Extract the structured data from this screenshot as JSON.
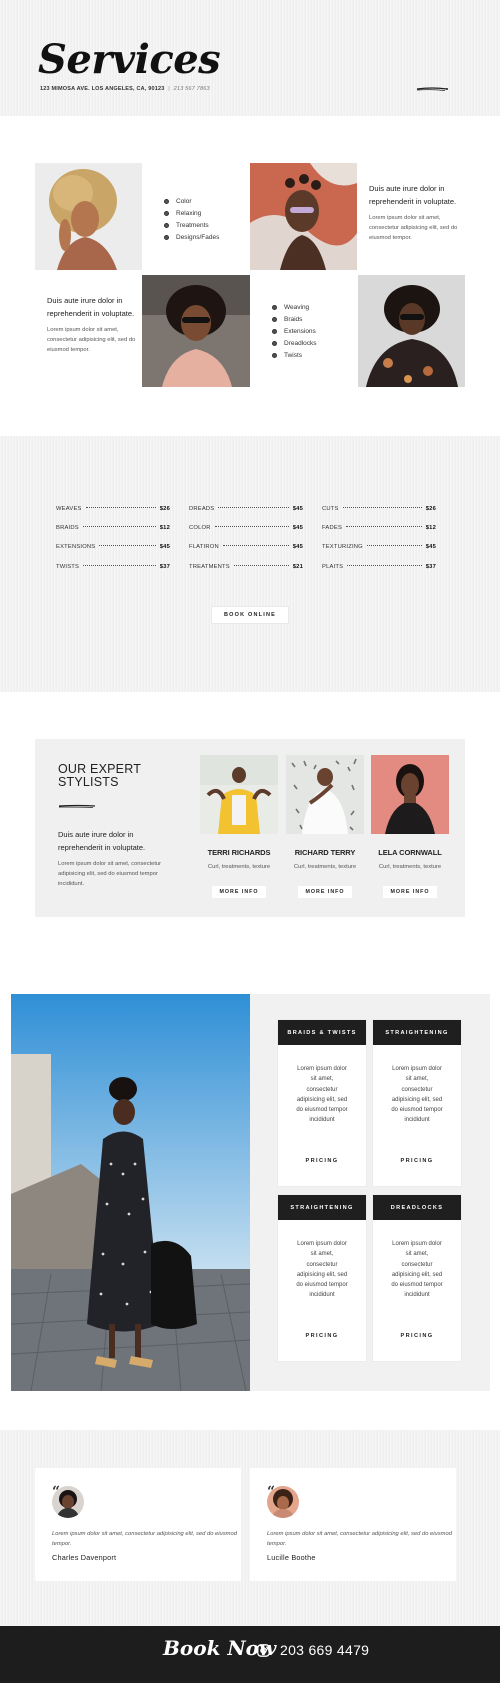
{
  "header": {
    "title": "Services",
    "address": "123 MIMOSA AVE. LOS ANGELES, CA, 90123",
    "separator": "|",
    "phone": "213 567 7863"
  },
  "services": {
    "list_one": [
      "Color",
      "Relaxing",
      "Treatments",
      "Designs/Fades"
    ],
    "list_two": [
      "Weaving",
      "Braids",
      "Extensions",
      "Dreadlocks",
      "Twists"
    ],
    "block_one": {
      "heading": "Duis aute irure dolor in reprehenderit in voluptate.",
      "body": "Lorem ipsum dolor sit amet, consectetur adipisicing elit, sed do eiusmod tempor."
    },
    "block_two": {
      "heading": "Duis aute irure dolor in reprehenderit in voluptate.",
      "body": "Lorem ipsum dolor sit amet, consectetur adipisicing elit, sed do eiusmod tempor."
    }
  },
  "prices": {
    "columns": [
      [
        {
          "name": "WEAVES",
          "price": "$26"
        },
        {
          "name": "BRAIDS",
          "price": "$12"
        },
        {
          "name": "EXTENSIONS",
          "price": "$45"
        },
        {
          "name": "TWISTS",
          "price": "$37"
        }
      ],
      [
        {
          "name": "DREADS",
          "price": "$45"
        },
        {
          "name": "COLOR",
          "price": "$45"
        },
        {
          "name": "FLATIRON",
          "price": "$45"
        },
        {
          "name": "TREATMENTS",
          "price": "$21"
        }
      ],
      [
        {
          "name": "CUTS",
          "price": "$26"
        },
        {
          "name": "FADES",
          "price": "$12"
        },
        {
          "name": "TEXTURIZING",
          "price": "$45"
        },
        {
          "name": "PLAITS",
          "price": "$37"
        }
      ]
    ],
    "book_button": "BOOK ONLINE"
  },
  "stylists": {
    "title_line1": "OUR EXPERT",
    "title_line2": "STYLISTS",
    "heading": "Duis aute irure dolor in reprehenderit in voluptate.",
    "body": "Lorem ipsum dolor sit amet, consectetur adipisicing elit, sed do eiusmod tempor incididunt.",
    "people": [
      {
        "name": "TERRI RICHARDS",
        "desc": "Curl, treatments, texture",
        "button": "MORE INFO"
      },
      {
        "name": "RICHARD TERRY",
        "desc": "Curl, treatments, texture",
        "button": "MORE INFO"
      },
      {
        "name": "LELA CORNWALL",
        "desc": "Curl, treatments, texture",
        "button": "MORE INFO"
      }
    ]
  },
  "pricing_cards": [
    {
      "title": "BRAIDS & TWISTS",
      "body": "Lorem ipsum dolor sit amet, consectetur adipisicing elit, sed do eiusmod tempor incididunt",
      "button": "PRICING"
    },
    {
      "title": "STRAIGHTENING",
      "body": "Lorem ipsum dolor sit amet, consectetur adipisicing elit, sed do eiusmod tempor incididunt",
      "button": "PRICING"
    },
    {
      "title": "STRAIGHTENING",
      "body": "Lorem ipsum dolor sit amet, consectetur adipisicing elit, sed do eiusmod tempor incididunt",
      "button": "PRICING"
    },
    {
      "title": "DREADLOCKS",
      "body": "Lorem ipsum dolor sit amet, consectetur adipisicing elit, sed do eiusmod tempor incididunt",
      "button": "PRICING"
    }
  ],
  "testimonials": [
    {
      "quote_mark": "“",
      "text": "Lorem ipsum dolor sit amet, consectetur adipisicing elit, sed do eiusmod tempor.",
      "author": "Charles Davenport"
    },
    {
      "quote_mark": "“",
      "text": "Lorem ipsum dolor sit amet, consectetur adipisicing elit, sed do eiusmod tempor.",
      "author": "Lucille Boothe"
    }
  ],
  "footer": {
    "book_now": "Book Now",
    "phone": "203 669 4479",
    "icon": "instagram-icon"
  },
  "colors": {
    "footer_bg": "#1d1d1d",
    "card_header_bg": "#1f1f1f",
    "band_bg": "#f1f1f1"
  }
}
